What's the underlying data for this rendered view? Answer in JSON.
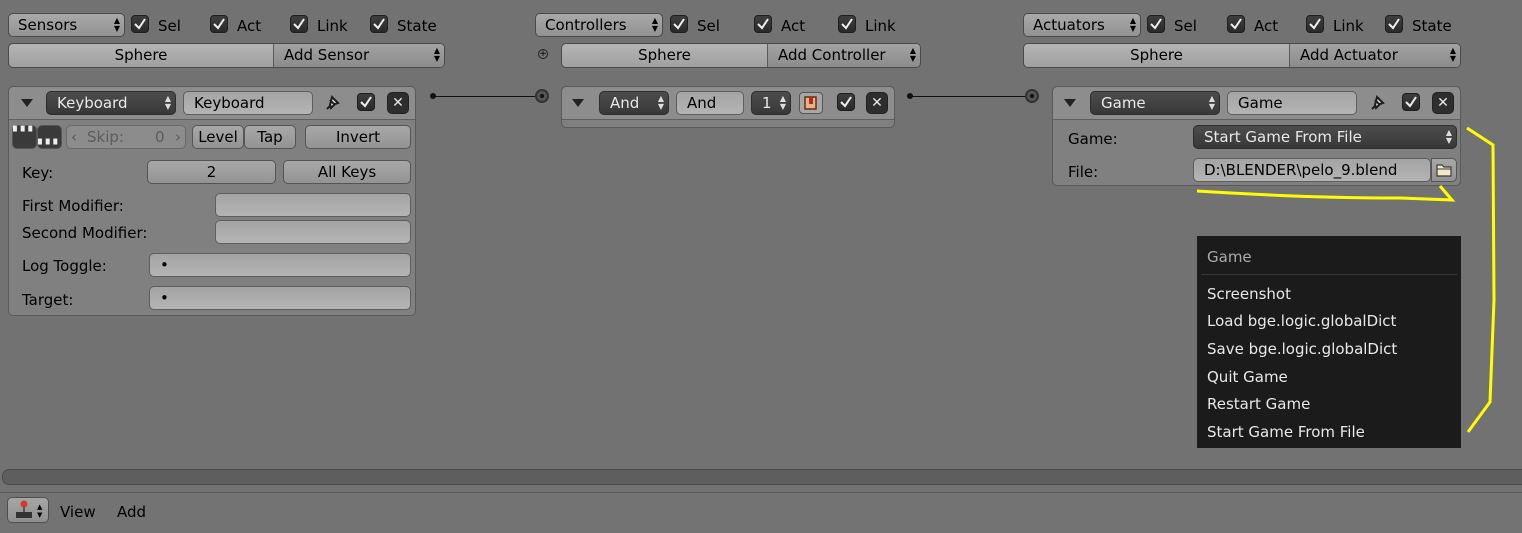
{
  "sensors_header": {
    "dropdown": "Sensors",
    "checks": [
      "Sel",
      "Act",
      "Link",
      "State"
    ],
    "object_label": "Sphere",
    "add_label": "Add Sensor"
  },
  "controllers_header": {
    "dropdown": "Controllers",
    "checks": [
      "Sel",
      "Act",
      "Link"
    ],
    "object_label": "Sphere",
    "add_label": "Add Controller"
  },
  "actuators_header": {
    "dropdown": "Actuators",
    "checks": [
      "Sel",
      "Act",
      "Link",
      "State"
    ],
    "object_label": "Sphere",
    "add_label": "Add Actuator"
  },
  "sensor": {
    "type": "Keyboard",
    "name": "Keyboard",
    "skip_label": "Skip:",
    "skip_value": "0",
    "level": "Level",
    "tap": "Tap",
    "invert": "Invert",
    "key_label": "Key:",
    "key_value": "2",
    "all_keys": "All Keys",
    "first_modifier_label": "First Modifier:",
    "second_modifier_label": "Second Modifier:",
    "log_toggle_label": "Log Toggle:",
    "target_label": "Target:",
    "log_toggle_value": "•",
    "target_value": "•"
  },
  "controller": {
    "type": "And",
    "name": "And",
    "state": "1"
  },
  "actuator": {
    "type": "Game",
    "name": "Game",
    "game_label": "Game:",
    "game_value": "Start Game From File",
    "file_label": "File:",
    "file_value": "D:\\BLENDER\\pelo_9.blend"
  },
  "menu": {
    "title": "Game",
    "items": [
      "Screenshot",
      "Load bge.logic.globalDict",
      "Save bge.logic.globalDict",
      "Quit Game",
      "Restart Game",
      "Start Game From File"
    ]
  },
  "footer": {
    "view": "View",
    "add": "Add"
  },
  "colors": {
    "annotation": "#ffff00",
    "menu_bg": "#141414",
    "panel": "#808080",
    "background": "#727272"
  }
}
